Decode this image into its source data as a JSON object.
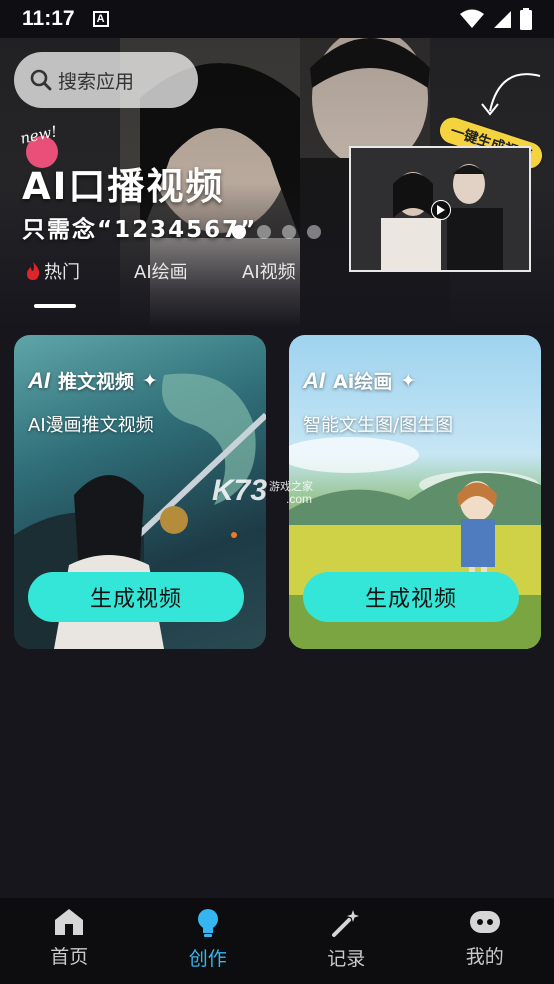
{
  "status_bar": {
    "time": "11:17",
    "notification_icon": "a-notification-icon"
  },
  "hero": {
    "search_placeholder": "搜索应用",
    "badge": "new!",
    "title": "AI口播视频",
    "subtitle": "只需念“1234567”",
    "preview_tag": "一键生成视频",
    "dots_count": 4
  },
  "tabs": [
    {
      "label": "热门",
      "icon": "fire-icon",
      "active": true
    },
    {
      "label": "AI绘画",
      "active": false
    },
    {
      "label": "AI视频",
      "active": false
    }
  ],
  "cards": [
    {
      "logo": "AI",
      "title": "推文视频",
      "subtitle": "AI漫画推文视频",
      "button": "生成视频"
    },
    {
      "logo": "AI",
      "title": "Ai绘画",
      "subtitle": "智能文生图/图生图",
      "button": "生成视频"
    }
  ],
  "watermark": {
    "main": "K73",
    "sub": "游戏之家",
    "com": ".com"
  },
  "bottom_nav": [
    {
      "label": "首页",
      "icon": "home-icon",
      "active": false
    },
    {
      "label": "创作",
      "icon": "lightbulb-icon",
      "active": true
    },
    {
      "label": "记录",
      "icon": "magic-wand-icon",
      "active": false
    },
    {
      "label": "我的",
      "icon": "robot-face-icon",
      "active": false
    }
  ],
  "colors": {
    "accent": "#33e6d8",
    "nav_active": "#36b6f0",
    "background": "#17161d"
  }
}
